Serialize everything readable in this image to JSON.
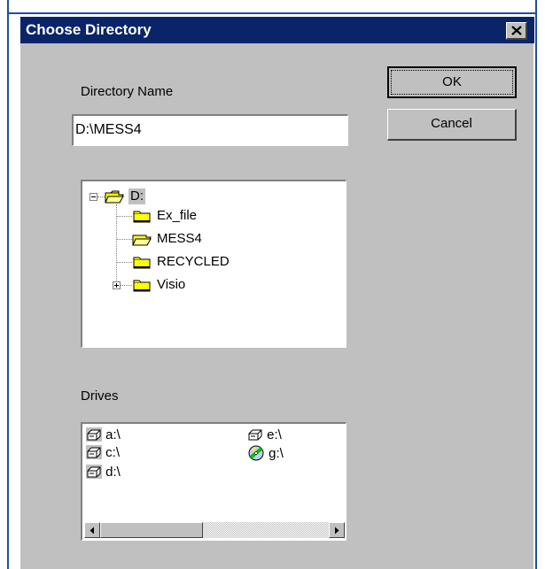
{
  "dialog": {
    "title": "Choose Directory",
    "close_glyph": "✕"
  },
  "directory_name": {
    "label": "Directory Name",
    "value": "D:\\MESS4"
  },
  "buttons": {
    "ok": "OK",
    "cancel": "Cancel"
  },
  "tree": {
    "root": {
      "label": "D:",
      "icon": "open-folder-icon",
      "expanded": true
    },
    "children": [
      {
        "label": "Ex_file",
        "icon": "folder-icon",
        "expandable": false
      },
      {
        "label": "MESS4",
        "icon": "open-folder-icon",
        "expandable": false,
        "selected": true
      },
      {
        "label": "RECYCLED",
        "icon": "folder-icon",
        "expandable": false
      },
      {
        "label": "Visio",
        "icon": "folder-icon",
        "expandable": true
      }
    ]
  },
  "drives": {
    "label": "Drives",
    "items": [
      {
        "label": "a:\\",
        "icon": "floppy-drive-icon"
      },
      {
        "label": "c:\\",
        "icon": "hard-drive-icon"
      },
      {
        "label": "d:\\",
        "icon": "hard-drive-icon"
      },
      {
        "label": "e:\\",
        "icon": "hard-drive-icon"
      },
      {
        "label": "g:\\",
        "icon": "cd-drive-icon"
      }
    ]
  },
  "colors": {
    "titlebar": "#0a246a",
    "dialog_face": "#c0c0c0",
    "folder_yellow": "#ffff00"
  }
}
